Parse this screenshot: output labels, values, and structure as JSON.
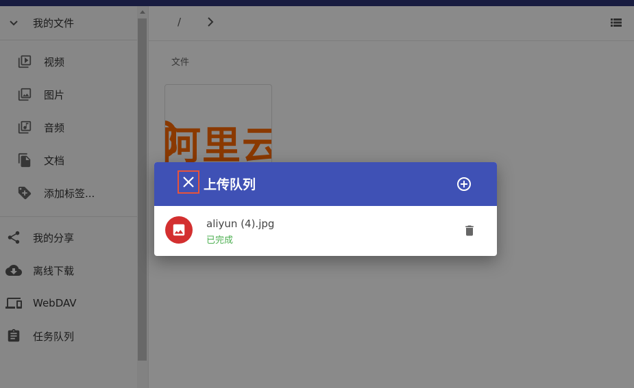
{
  "sidebar": {
    "header_label": "我的文件",
    "file_types": [
      {
        "label": "视频",
        "icon": "video-library-icon"
      },
      {
        "label": "图片",
        "icon": "photo-library-icon"
      },
      {
        "label": "音频",
        "icon": "music-library-icon"
      },
      {
        "label": "文档",
        "icon": "file-copy-icon"
      },
      {
        "label": "添加标签...",
        "icon": "add-tag-icon"
      }
    ],
    "links": [
      {
        "label": "我的分享",
        "icon": "share-icon"
      },
      {
        "label": "离线下载",
        "icon": "cloud-download-icon"
      },
      {
        "label": "WebDAV",
        "icon": "devices-icon"
      },
      {
        "label": "任务队列",
        "icon": "clipboard-icon"
      }
    ]
  },
  "breadcrumb": {
    "root": "/"
  },
  "main": {
    "section_label": "文件"
  },
  "thumbnail": {
    "text": "阿里云"
  },
  "dialog": {
    "title": "上传队列",
    "items": [
      {
        "name": "aliyun (4).jpg",
        "status": "已完成"
      }
    ]
  },
  "colors": {
    "primary": "#3f51b5",
    "top_bar": "#2d3577",
    "file_avatar": "#d32f2f",
    "success": "#4caf50",
    "highlight_box": "#e8543a",
    "brand_orange": "#ff6a00"
  }
}
